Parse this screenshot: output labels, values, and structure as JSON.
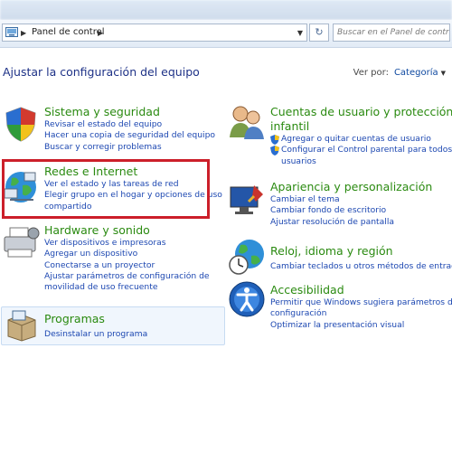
{
  "address": {
    "crumb": "Panel de control"
  },
  "search": {
    "placeholder": "Buscar en el Panel de control"
  },
  "heading": "Ajustar la configuración del equipo",
  "viewby": {
    "label": "Ver por:",
    "value": "Categoría"
  },
  "categories": {
    "sistema": {
      "title": "Sistema y seguridad",
      "links": [
        "Revisar el estado del equipo",
        "Hacer una copia de seguridad del equipo",
        "Buscar y corregir problemas"
      ]
    },
    "redes": {
      "title": "Redes e Internet",
      "links": [
        "Ver el estado y las tareas de red",
        "Elegir grupo en el hogar y opciones de uso",
        "compartido"
      ]
    },
    "hardware": {
      "title": "Hardware y sonido",
      "links": [
        "Ver dispositivos e impresoras",
        "Agregar un dispositivo",
        "Conectarse a un proyector",
        "Ajustar parámetros de configuración de",
        "movilidad de uso frecuente"
      ]
    },
    "programas": {
      "title": "Programas",
      "links": [
        "Desinstalar un programa"
      ]
    },
    "cuentas": {
      "title_lines": [
        "Cuentas de usuario y protección",
        "infantil"
      ],
      "links": [
        "Agregar o quitar cuentas de usuario",
        "Configurar el Control parental para todos los",
        "usuarios"
      ]
    },
    "apariencia": {
      "title": "Apariencia y personalización",
      "links": [
        "Cambiar el tema",
        "Cambiar fondo de escritorio",
        "Ajustar resolución de pantalla"
      ]
    },
    "reloj": {
      "title": "Reloj, idioma y región",
      "links": [
        "Cambiar teclados u otros métodos de entrada"
      ]
    },
    "accesibilidad": {
      "title": "Accesibilidad",
      "links": [
        "Permitir que Windows sugiera parámetros de",
        "configuración",
        "Optimizar la presentación visual"
      ]
    }
  }
}
